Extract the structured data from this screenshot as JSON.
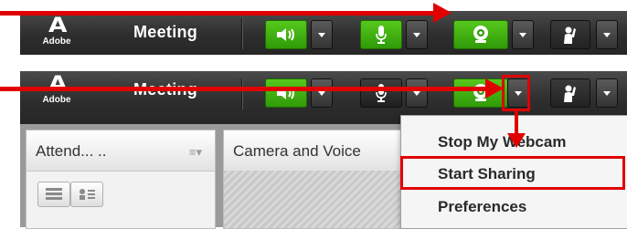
{
  "logo": {
    "mark": "A",
    "word": "Adobe"
  },
  "menubar": {
    "title": "Meeting"
  },
  "pods": {
    "attendees": {
      "title": "Attend... .."
    },
    "camera": {
      "title": "Camera and Voice"
    }
  },
  "webcam_menu": {
    "items": [
      "Stop My Webcam",
      "Start Sharing",
      "Preferences"
    ],
    "highlighted": "Start Sharing"
  },
  "colors": {
    "annotation": "#e00000",
    "active_green": "#3fb00f"
  },
  "icons": [
    "adobe-logo",
    "speaker-icon",
    "microphone-icon",
    "webcam-icon",
    "raise-hand-icon",
    "list-view-icon",
    "grid-view-icon",
    "pod-menu-icon",
    "chevron-down-icon"
  ]
}
